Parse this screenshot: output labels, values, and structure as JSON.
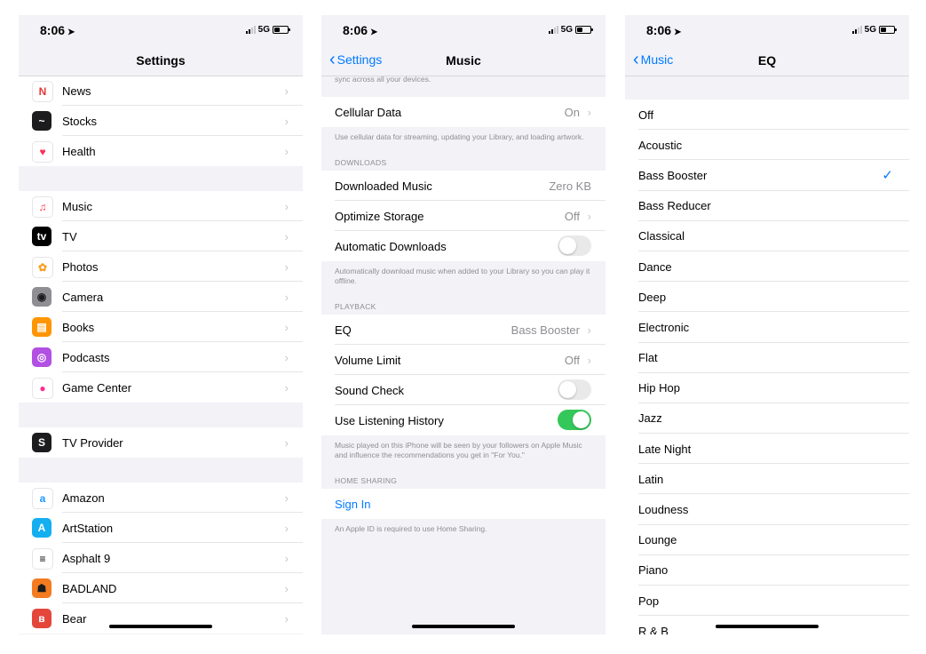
{
  "status": {
    "time": "8:06",
    "network": "5G"
  },
  "screens": [
    {
      "title": "Settings",
      "groups": [
        [
          {
            "label": "News",
            "icon": "news-icon",
            "color": "#ffffff",
            "glyph": "N",
            "fg": "#e53935"
          },
          {
            "label": "Stocks",
            "icon": "stocks-icon",
            "color": "#1c1c1e",
            "glyph": "~",
            "fg": "#ffffff"
          },
          {
            "label": "Health",
            "icon": "heart-icon",
            "color": "#ffffff",
            "glyph": "♥",
            "fg": "#ff2d55"
          }
        ],
        [
          {
            "label": "Music",
            "icon": "music-note-icon",
            "color": "#ffffff",
            "glyph": "♫",
            "fg": "#fc3c44"
          },
          {
            "label": "TV",
            "icon": "apple-tv-icon",
            "color": "#000000",
            "glyph": "tv",
            "fg": "#ffffff"
          },
          {
            "label": "Photos",
            "icon": "photos-icon",
            "color": "#ffffff",
            "glyph": "✿",
            "fg": "#f79f1f"
          },
          {
            "label": "Camera",
            "icon": "camera-icon",
            "color": "#8e8e93",
            "glyph": "◉",
            "fg": "#1c1c1e"
          },
          {
            "label": "Books",
            "icon": "books-icon",
            "color": "#ff9500",
            "glyph": "▤",
            "fg": "#ffffff"
          },
          {
            "label": "Podcasts",
            "icon": "podcasts-icon",
            "color": "#b150e2",
            "glyph": "◎",
            "fg": "#ffffff"
          },
          {
            "label": "Game Center",
            "icon": "game-center-icon",
            "color": "#ffffff",
            "glyph": "●",
            "fg": "#ff2d92"
          }
        ],
        [
          {
            "label": "TV Provider",
            "icon": "tv-provider-icon",
            "color": "#1c1c1e",
            "glyph": "S",
            "fg": "#ffffff"
          }
        ],
        [
          {
            "label": "Amazon",
            "icon": "amazon-icon",
            "color": "#ffffff",
            "glyph": "a",
            "fg": "#1a98ff"
          },
          {
            "label": "ArtStation",
            "icon": "artstation-icon",
            "color": "#13aff0",
            "glyph": "A",
            "fg": "#ffffff"
          },
          {
            "label": "Asphalt 9",
            "icon": "asphalt-icon",
            "color": "#ffffff",
            "glyph": "≡",
            "fg": "#000000"
          },
          {
            "label": "BADLAND",
            "icon": "badland-icon",
            "color": "#f47b20",
            "glyph": "☗",
            "fg": "#1c1c1e"
          },
          {
            "label": "Bear",
            "icon": "bear-icon",
            "color": "#e4463b",
            "glyph": "ʙ",
            "fg": "#ffffff"
          }
        ]
      ]
    },
    {
      "title": "Music",
      "back": "Settings",
      "top_footer": "sync across all your devices.",
      "cellular": {
        "label": "Cellular Data",
        "value": "On"
      },
      "cellular_footer": "Use cellular data for streaming, updating your Library, and loading artwork.",
      "downloads_header": "DOWNLOADS",
      "downloaded": {
        "label": "Downloaded Music",
        "value": "Zero KB"
      },
      "optimize": {
        "label": "Optimize Storage",
        "value": "Off"
      },
      "auto_downloads": {
        "label": "Automatic Downloads",
        "on": false
      },
      "downloads_footer": "Automatically download music when added to your Library so you can play it offline.",
      "playback_header": "PLAYBACK",
      "eq": {
        "label": "EQ",
        "value": "Bass Booster"
      },
      "volume_limit": {
        "label": "Volume Limit",
        "value": "Off"
      },
      "sound_check": {
        "label": "Sound Check",
        "on": false
      },
      "listening_history": {
        "label": "Use Listening History",
        "on": true
      },
      "playback_footer": "Music played on this iPhone will be seen by your followers on Apple Music and influence the recommendations you get in \"For You.\"",
      "home_sharing_header": "HOME SHARING",
      "sign_in": "Sign In",
      "home_sharing_footer": "An Apple ID is required to use Home Sharing."
    },
    {
      "title": "EQ",
      "back": "Music",
      "options": [
        "Off",
        "Acoustic",
        "Bass Booster",
        "Bass Reducer",
        "Classical",
        "Dance",
        "Deep",
        "Electronic",
        "Flat",
        "Hip Hop",
        "Jazz",
        "Late Night",
        "Latin",
        "Loudness",
        "Lounge",
        "Piano",
        "Pop",
        "R & B"
      ],
      "selected": "Bass Booster"
    }
  ]
}
